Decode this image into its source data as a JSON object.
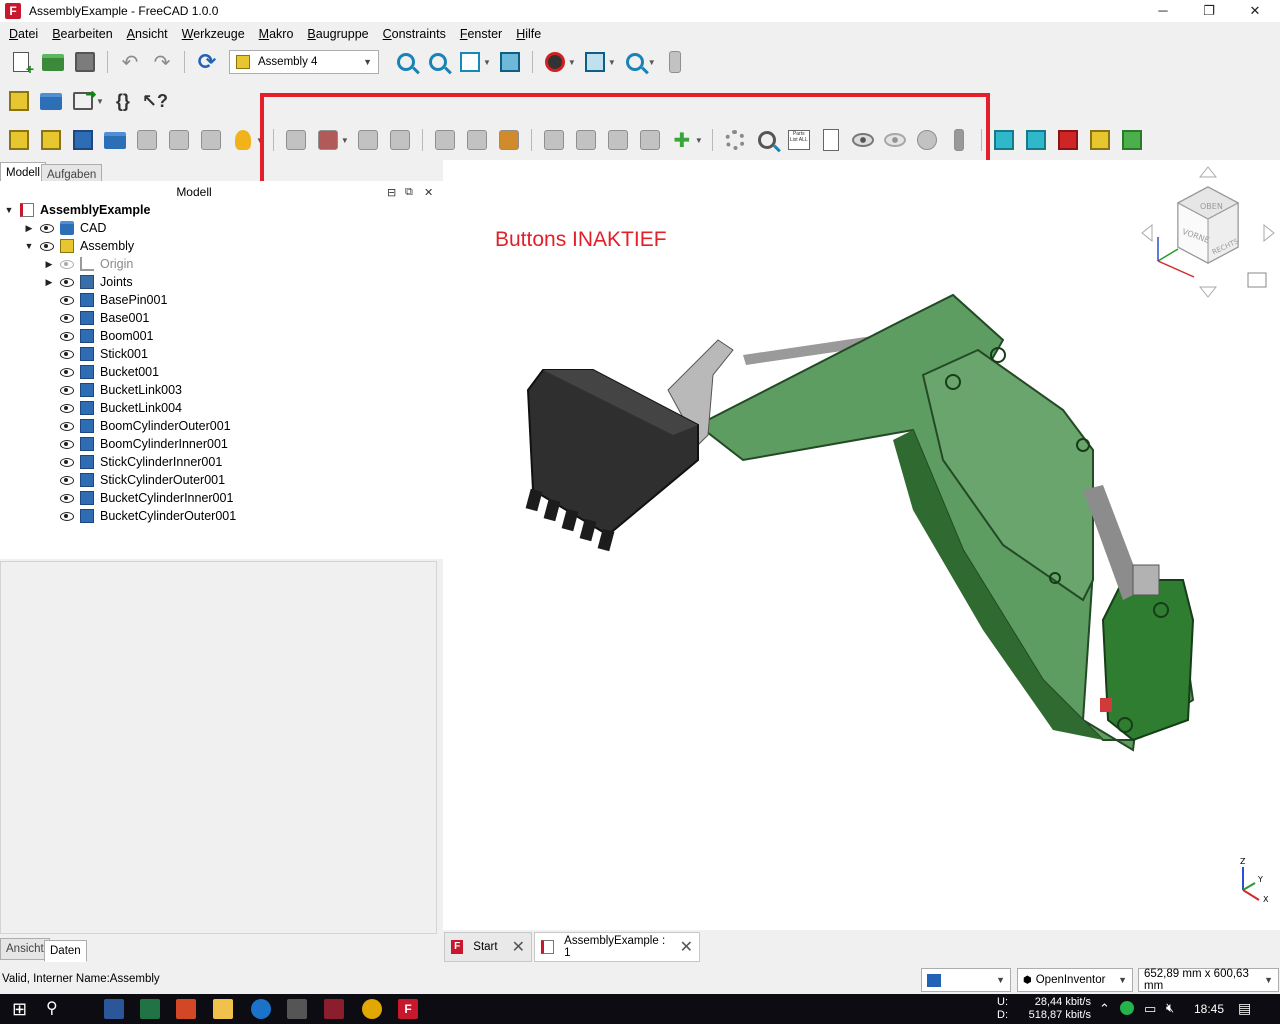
{
  "window": {
    "title": "AssemblyExample - FreeCAD 1.0.0",
    "minimize": "─",
    "maximize": "❐",
    "close": "✕"
  },
  "menu": [
    "Datei",
    "Bearbeiten",
    "Ansicht",
    "Werkzeuge",
    "Makro",
    "Baugruppe",
    "Constraints",
    "Fenster",
    "Hilfe"
  ],
  "workbench_selector": {
    "value": "Assembly 4"
  },
  "annotation": {
    "text": "Buttons INAKTIEF",
    "color": "#e3202a"
  },
  "left_panel": {
    "tabs": [
      "Modell",
      "Aufgaben"
    ],
    "header": "Modell",
    "tree": [
      {
        "label": "AssemblyExample",
        "level": 0,
        "icon": "document-icon",
        "bold": true,
        "expanded": true
      },
      {
        "label": "CAD",
        "level": 1,
        "icon": "folder-icon",
        "visible": true,
        "collapsed": true
      },
      {
        "label": "Assembly",
        "level": 1,
        "icon": "assembly-icon",
        "visible": true,
        "expanded": true
      },
      {
        "label": "Origin",
        "level": 2,
        "icon": "origin-icon",
        "visible": false,
        "collapsed": true,
        "greyed": true
      },
      {
        "label": "Joints",
        "level": 2,
        "icon": "joints-icon",
        "visible": true,
        "collapsed": true
      },
      {
        "label": "BasePin001",
        "level": 2,
        "icon": "part-icon",
        "visible": true
      },
      {
        "label": "Base001",
        "level": 2,
        "icon": "part-icon",
        "visible": true
      },
      {
        "label": "Boom001",
        "level": 2,
        "icon": "part-icon",
        "visible": true
      },
      {
        "label": "Stick001",
        "level": 2,
        "icon": "part-icon",
        "visible": true
      },
      {
        "label": "Bucket001",
        "level": 2,
        "icon": "part-icon",
        "visible": true
      },
      {
        "label": "BucketLink003",
        "level": 2,
        "icon": "part-icon",
        "visible": true
      },
      {
        "label": "BucketLink004",
        "level": 2,
        "icon": "part-icon",
        "visible": true
      },
      {
        "label": "BoomCylinderOuter001",
        "level": 2,
        "icon": "part-icon",
        "visible": true
      },
      {
        "label": "BoomCylinderInner001",
        "level": 2,
        "icon": "part-icon",
        "visible": true
      },
      {
        "label": "StickCylinderInner001",
        "level": 2,
        "icon": "part-icon",
        "visible": true
      },
      {
        "label": "StickCylinderOuter001",
        "level": 2,
        "icon": "part-icon",
        "visible": true
      },
      {
        "label": "BucketCylinderInner001",
        "level": 2,
        "icon": "part-icon",
        "visible": true
      },
      {
        "label": "BucketCylinderOuter001",
        "level": 2,
        "icon": "part-icon",
        "visible": true
      }
    ],
    "bottom_tabs": [
      "Ansicht",
      "Daten"
    ]
  },
  "navcube": {
    "top": "OBEN",
    "front": "VORNE",
    "right": "RECHTS"
  },
  "axis": {
    "z": "Z",
    "y": "Y",
    "x": "X"
  },
  "doc_tabs": [
    {
      "label": "Start"
    },
    {
      "label": "AssemblyExample : 1"
    }
  ],
  "status": {
    "message": "Valid, Interner Name:Assembly",
    "nav_style": "OpenInventor",
    "dimensions": "652,89 mm x 600,63 mm"
  },
  "taskbar": {
    "upload_label": "U:",
    "download_label": "D:",
    "upload": "28,44 kbit/s",
    "download": "518,87 kbit/s",
    "time": "18:45"
  }
}
